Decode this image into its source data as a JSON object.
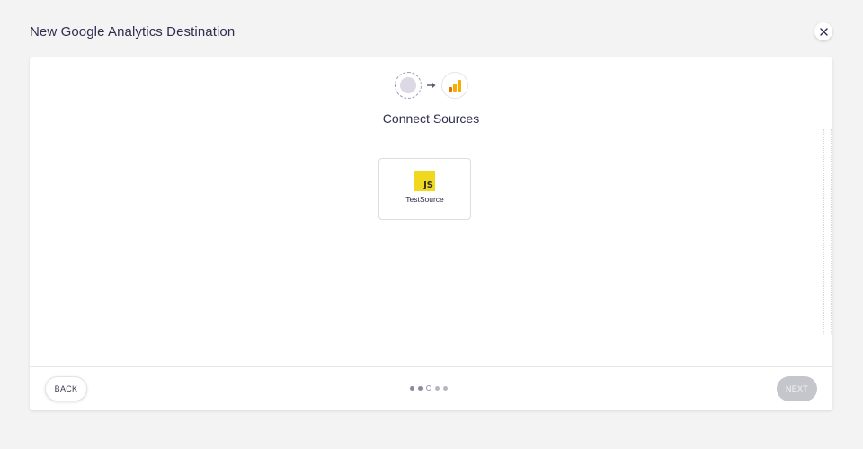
{
  "header": {
    "title": "New Google Analytics Destination",
    "close_icon": "close-icon"
  },
  "flow": {
    "source_icon": "source-placeholder-icon",
    "arrow_icon": "arrow-right-icon",
    "destination_icon": "google-analytics-icon"
  },
  "step": {
    "title": "Connect Sources"
  },
  "sources": [
    {
      "name": "TestSource",
      "icon": "javascript-icon",
      "logo_text": "JS"
    }
  ],
  "footer": {
    "back_label": "BACK",
    "next_label": "NEXT",
    "steps_total": 5,
    "current_step": 3
  },
  "colors": {
    "background": "#f3f3f4",
    "panel": "#ffffff",
    "text": "#2f2f4f",
    "js_yellow": "#f0d81e",
    "ga_orange": "#f9ab00",
    "ga_orange_dark": "#e37400",
    "next_disabled": "#c5c5cc"
  }
}
